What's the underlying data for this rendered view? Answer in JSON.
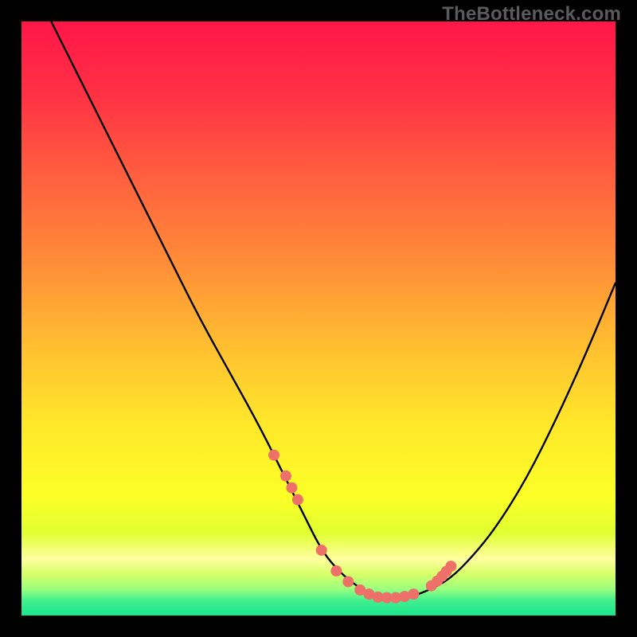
{
  "watermark": "TheBottleneck.com",
  "colors": {
    "black": "#000000",
    "watermark": "#5b5b5b",
    "curve": "#000000",
    "dot_fill": "#ed7169",
    "gradient_stops": [
      {
        "offset": 0.0,
        "color": "#ff1648"
      },
      {
        "offset": 0.12,
        "color": "#ff3044"
      },
      {
        "offset": 0.25,
        "color": "#ff5c3f"
      },
      {
        "offset": 0.4,
        "color": "#ff8b38"
      },
      {
        "offset": 0.55,
        "color": "#ffc030"
      },
      {
        "offset": 0.68,
        "color": "#ffe82a"
      },
      {
        "offset": 0.8,
        "color": "#fcff26"
      },
      {
        "offset": 0.86,
        "color": "#e0ff30"
      },
      {
        "offset": 0.905,
        "color": "#ffffa0"
      },
      {
        "offset": 0.93,
        "color": "#d7ff68"
      },
      {
        "offset": 0.955,
        "color": "#9bff7e"
      },
      {
        "offset": 0.975,
        "color": "#41ef8f"
      },
      {
        "offset": 1.0,
        "color": "#19e68b"
      }
    ]
  },
  "chart_data": {
    "type": "line",
    "title": "",
    "xlabel": "",
    "ylabel": "",
    "xlim": [
      0,
      100
    ],
    "ylim": [
      0,
      100
    ],
    "grid": false,
    "series": [
      {
        "name": "curve",
        "x": [
          5,
          10,
          15,
          20,
          25,
          30,
          35,
          40,
          45,
          48,
          50,
          52,
          55,
          58,
          60,
          62,
          65,
          68,
          72,
          76,
          80,
          85,
          90,
          95,
          100
        ],
        "y": [
          100,
          90,
          80,
          70,
          60,
          50,
          41,
          32,
          22,
          16,
          12,
          9,
          6,
          4,
          3,
          3,
          3,
          4,
          6,
          10,
          15,
          23,
          33,
          44,
          56
        ]
      }
    ],
    "dots": {
      "name": "highlighted-points",
      "x": [
        42.5,
        44.5,
        45.5,
        46.5,
        50.5,
        53,
        55,
        57,
        58.5,
        60,
        61.5,
        63,
        64.5,
        66,
        69,
        70,
        70.8,
        71.5,
        72.3
      ],
      "y": [
        27,
        23.5,
        21.5,
        19.5,
        11,
        7.5,
        5.7,
        4.3,
        3.6,
        3.1,
        3.0,
        3.0,
        3.2,
        3.6,
        5.0,
        5.8,
        6.6,
        7.4,
        8.3
      ],
      "r": 7
    }
  }
}
